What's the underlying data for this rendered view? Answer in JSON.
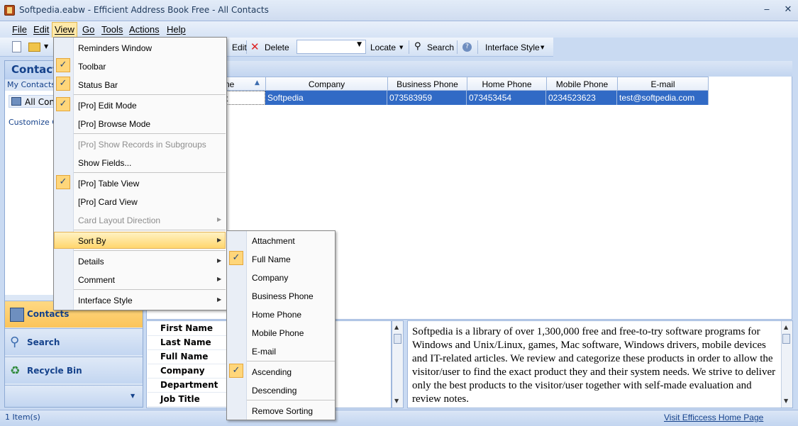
{
  "window": {
    "title": "Softpedia.eabw - Efficient Address Book Free - All Contacts",
    "minimize": "‒",
    "close": "✕"
  },
  "menubar": [
    "File",
    "Edit",
    "View",
    "Go",
    "Tools",
    "Actions",
    "Help"
  ],
  "toolbar": {
    "edit_label": "Edit",
    "delete_label": "Delete",
    "locate_label": "Locate",
    "search_label": "Search",
    "interface_style_label": "Interface Style"
  },
  "left_pane": {
    "header": "Contacts",
    "my_contacts": "My Contacts",
    "all_contacts": "All Con",
    "customize": "Customize Cu",
    "nav": [
      "Contacts",
      "Search",
      "Recycle Bin"
    ]
  },
  "grid": {
    "columns": [
      "ne",
      "Company",
      "Business Phone",
      "Home Phone",
      "Mobile Phone",
      "E-mail"
    ],
    "row": {
      "name": "t",
      "company": "Softpedia",
      "business_phone": "073583959",
      "home_phone": "073453454",
      "mobile_phone": "0234523623",
      "email": "test@softpedia.com"
    }
  },
  "fields": [
    "First Name",
    "Last Name",
    "Full Name",
    "Company",
    "Department",
    "Job Title"
  ],
  "notes": "Softpedia is a library of over 1,300,000 free and free-to-try software programs for Windows and Unix/Linux, games, Mac software, Windows drivers, mobile devices and IT-related articles. We review and categorize these products in order to allow the visitor/user to find the exact product they and their system needs. We strive to deliver only the best products to the visitor/user together with self-made evaluation and review notes.",
  "status": {
    "items": "1 Item(s)",
    "link": "Visit Efficcess Home Page"
  },
  "view_menu": [
    "Reminders Window",
    "Toolbar",
    "Status Bar",
    "[Pro] Edit Mode",
    "[Pro] Browse Mode",
    "[Pro] Show Records in Subgroups",
    "Show Fields...",
    "[Pro] Table View",
    "[Pro] Card View",
    "Card Layout Direction",
    "Sort By",
    "Details",
    "Comment",
    "Interface Style"
  ],
  "sort_menu": [
    "Attachment",
    "Full Name",
    "Company",
    "Business Phone",
    "Home Phone",
    "Mobile Phone",
    "E-mail",
    "Ascending",
    "Descending",
    "Remove Sorting"
  ],
  "check_mark": "✓"
}
